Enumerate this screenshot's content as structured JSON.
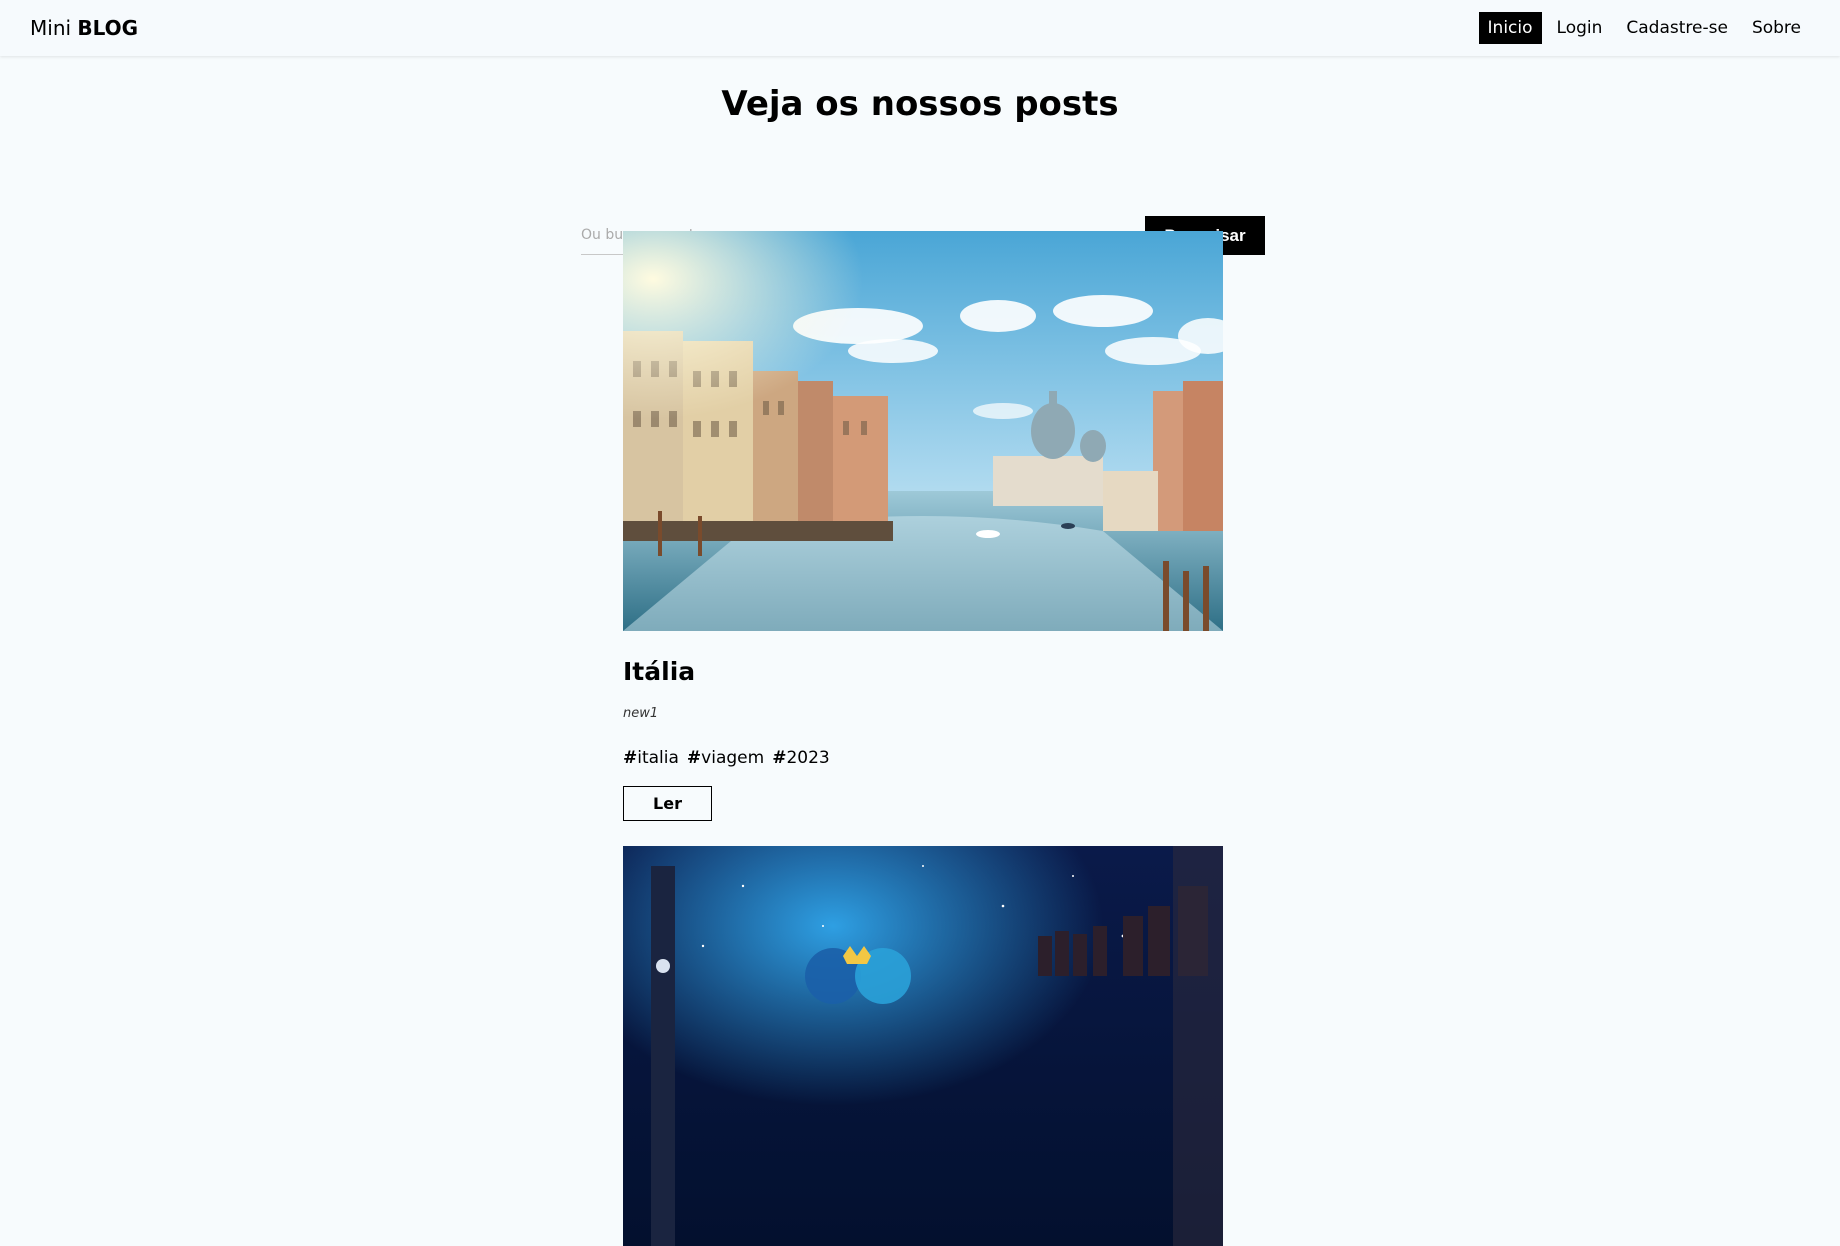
{
  "navbar": {
    "brand_prefix": "Mini",
    "brand_strong": "BLOG",
    "links": [
      {
        "label": "Inicio",
        "active": true
      },
      {
        "label": "Login"
      },
      {
        "label": "Cadastre-se"
      },
      {
        "label": "Sobre"
      }
    ]
  },
  "home": {
    "title": "Veja os nossos posts",
    "search_placeholder": "Ou busque por tags",
    "search_button": "Pesquisar"
  },
  "posts": [
    {
      "title": "Itália",
      "author": "new1",
      "tags": [
        "italia",
        "viagem",
        "2023"
      ],
      "read_label": "Ler"
    }
  ],
  "tag_prefix": "#",
  "colors": {
    "background": "#f7fbfd",
    "active_link_bg": "#000000",
    "button_bg": "#000000"
  }
}
